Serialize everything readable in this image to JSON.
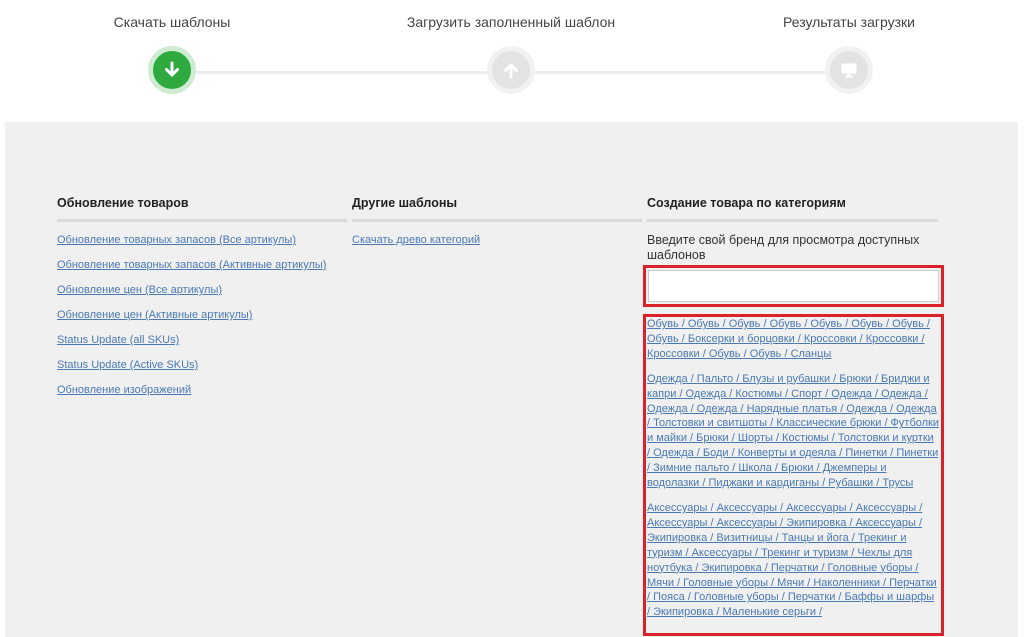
{
  "stepper": {
    "steps": [
      {
        "label": "Скачать шаблоны",
        "icon": "download-arrow-icon",
        "state": "active"
      },
      {
        "label": "Загрузить заполненный шаблон",
        "icon": "upload-arrow-icon",
        "state": "inactive"
      },
      {
        "label": "Результаты загрузки",
        "icon": "monitor-icon",
        "state": "inactive"
      }
    ],
    "colors": {
      "active": "#2eaa3f",
      "inactive": "#e3e3e3"
    }
  },
  "columns": {
    "update": {
      "title": "Обновление товаров",
      "links": [
        "Обновление товарных запасов (Все артикулы)",
        "Обновление товарных запасов (Активные артикулы)",
        "Обновление цен (Все артикулы)",
        "Обновление цен (Активные артикулы)",
        "Status Update (all SKUs)",
        "Status Update (Active SKUs)",
        "Обновление изображений"
      ]
    },
    "other": {
      "title": "Другие шаблоны",
      "links": [
        "Скачать древо категорий"
      ]
    },
    "create": {
      "title": "Создание товара по категориям",
      "brand_hint": "Введите свой бренд для просмотра доступных шаблонов",
      "brand_input_value": "",
      "category_groups": [
        "Обувь / Обувь / Обувь / Обувь / Обувь / Обувь / Обувь / Обувь / Боксерки и борцовки / Кроссовки / Кроссовки / Кроссовки / Обувь / Обувь / Сланцы",
        "Одежда / Пальто / Блузы и рубашки / Брюки / Бриджи и капри / Одежда / Костюмы / Спорт / Одежда / Одежда / Одежда / Одежда / Нарядные платья / Одежда / Одежда / Толстовки и свитшоты / Классические брюки / Футболки и майки / Брюки / Шорты / Костюмы / Толстовки и куртки / Одежда / Боди / Конверты и одеяла / Пинетки / Пинетки / Зимние пальто / Школа / Брюки / Джемперы и водолазки / Пиджаки и кардиганы / Рубашки / Трусы",
        "Аксессуары / Аксессуары / Аксессуары / Аксессуары / Аксессуары / Аксессуары / Экипировка / Аксессуары / Экипировка / Визитницы / Танцы и йога / Трекинг и туризм / Аксессуары / Трекинг и туризм / Чехлы для ноутбука / Экипировка / Перчатки / Головные уборы / Мячи / Головные уборы / Мячи / Наколенники / Перчатки / Пояса / Головные уборы / Перчатки / Баффы и шарфы / Экипировка / Маленькие серьги /"
      ]
    }
  },
  "colors": {
    "highlight_border": "#d9222a",
    "link": "#4a7ab3",
    "panel_bg": "#f0f0f0"
  }
}
